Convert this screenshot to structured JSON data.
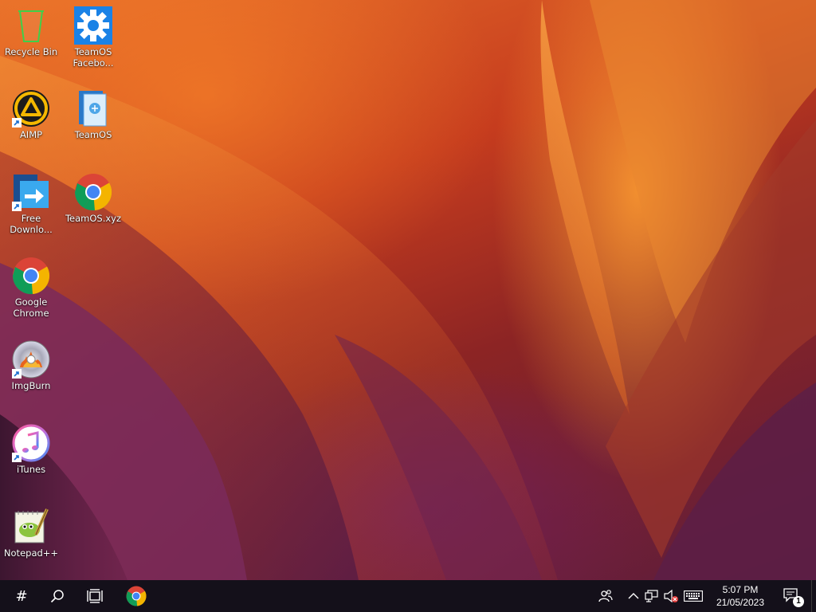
{
  "desktop": {
    "icons": [
      {
        "id": "recycle-bin",
        "label": "Recycle Bin"
      },
      {
        "id": "teamos-facebook",
        "label": "TeamOS\nFacebo..."
      },
      {
        "id": "aimp",
        "label": "AIMP"
      },
      {
        "id": "teamos",
        "label": "TeamOS"
      },
      {
        "id": "free-download-manager",
        "label": "Free\nDownlo..."
      },
      {
        "id": "teamos-xyz",
        "label": "TeamOS.xyz"
      },
      {
        "id": "google-chrome",
        "label": "Google\nChrome"
      },
      {
        "id": "imgburn",
        "label": "ImgBurn"
      },
      {
        "id": "itunes",
        "label": "iTunes"
      },
      {
        "id": "notepad-plus-plus",
        "label": "Notepad++"
      }
    ]
  },
  "taskbar": {
    "start_symbol": "#",
    "pinned": [
      {
        "id": "search",
        "icon": "search-icon"
      },
      {
        "id": "task-view",
        "icon": "task-view-icon"
      },
      {
        "id": "chrome",
        "icon": "chrome-icon"
      }
    ],
    "tray": {
      "icons": [
        "people-icon",
        "chevron-up-icon",
        "network-icon",
        "volume-muted-icon",
        "keyboard-icon"
      ],
      "time": "5:07 PM",
      "date": "21/05/2023",
      "notification_count": "1"
    }
  },
  "colors": {
    "taskbar_bg": "#14101a",
    "wallpaper_orange": "#e8702a",
    "wallpaper_red": "#c63c1e",
    "wallpaper_purple": "#5e1d3c",
    "chrome_red": "#db4437",
    "chrome_yellow": "#f4b400",
    "chrome_green": "#0f9d58",
    "chrome_blue": "#4285f4"
  }
}
